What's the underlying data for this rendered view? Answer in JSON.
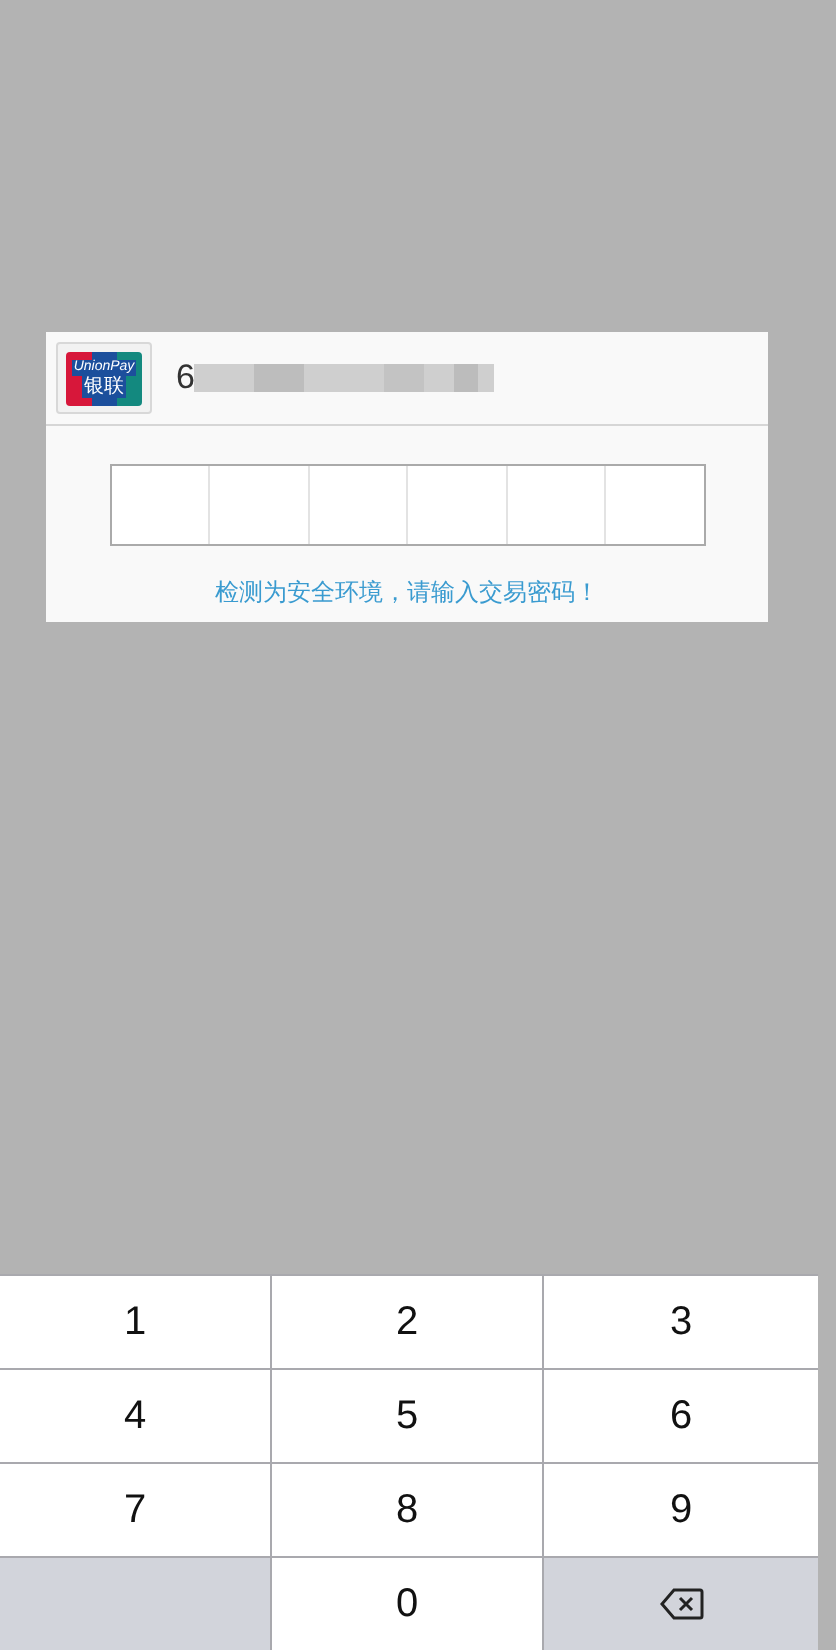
{
  "dialog": {
    "card": {
      "logo_text": "UnionPay",
      "logo_text_cn": "银联",
      "number_visible": "6"
    },
    "password_cells": [
      {
        "filled": false
      },
      {
        "filled": false
      },
      {
        "filled": false
      },
      {
        "filled": false
      },
      {
        "filled": false
      },
      {
        "filled": false
      }
    ],
    "hint": "检测为安全环境，请输入交易密码！"
  },
  "keypad": [
    {
      "kind": "digit",
      "label": "1"
    },
    {
      "kind": "digit",
      "label": "2"
    },
    {
      "kind": "digit",
      "label": "3"
    },
    {
      "kind": "digit",
      "label": "4"
    },
    {
      "kind": "digit",
      "label": "5"
    },
    {
      "kind": "digit",
      "label": "6"
    },
    {
      "kind": "digit",
      "label": "7"
    },
    {
      "kind": "digit",
      "label": "8"
    },
    {
      "kind": "digit",
      "label": "9"
    },
    {
      "kind": "blank"
    },
    {
      "kind": "digit",
      "label": "0"
    },
    {
      "kind": "delete"
    }
  ]
}
